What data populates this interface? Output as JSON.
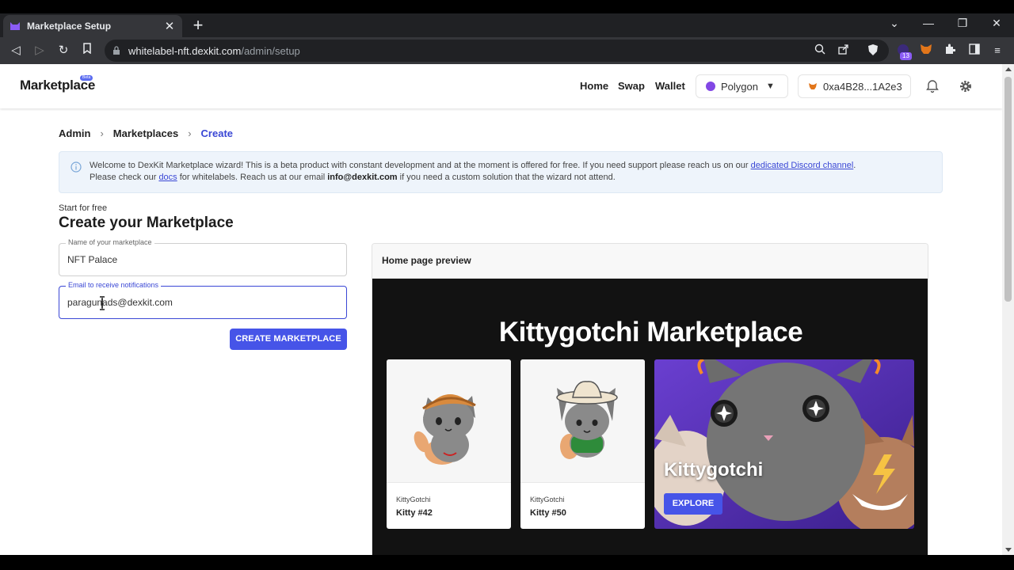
{
  "browser": {
    "tab_title": "Marketplace Setup",
    "url_host": "whitelabel-nft.dexkit.com",
    "url_path": "/admin/setup",
    "extension_badge": "13"
  },
  "header": {
    "logo": "Marketplace",
    "logo_badge": "Beta",
    "nav": [
      "Home",
      "Swap",
      "Wallet"
    ],
    "network": "Polygon",
    "wallet": "0xa4B28...1A2e3"
  },
  "breadcrumb": [
    "Admin",
    "Marketplaces",
    "Create"
  ],
  "alert": {
    "text_1": "Welcome to DexKit Marketplace wizard! This is a beta product with constant development and at the moment is offered for free. If you need support please reach us on our ",
    "link_discord": "dedicated Discord channel",
    "text_2": ".",
    "text_3": "Please check our ",
    "link_docs": "docs",
    "text_4": " for whitelabels. Reach us at our email ",
    "email": "info@dexkit.com",
    "text_5": " if you need a custom solution that the wizard not attend."
  },
  "form": {
    "kicker": "Start for free",
    "heading": "Create your Marketplace",
    "name_label": "Name of your marketplace",
    "name_value": "NFT Palace",
    "email_label": "Email to receive notifications",
    "email_value": "paragunads@dexkit.com",
    "submit": "CREATE MARKETPLACE"
  },
  "preview": {
    "header": "Home page preview",
    "title": "Kittygotchi Marketplace",
    "cards": [
      {
        "collection": "KittyGotchi",
        "name": "Kitty #42"
      },
      {
        "collection": "KittyGotchi",
        "name": "Kitty #50"
      }
    ],
    "hero_title": "Kittygotchi",
    "hero_button": "EXPLORE"
  },
  "colors": {
    "primary": "#4654e8",
    "link": "#3a47d5",
    "polygon": "#8247e5",
    "preview_bg": "#121212"
  }
}
